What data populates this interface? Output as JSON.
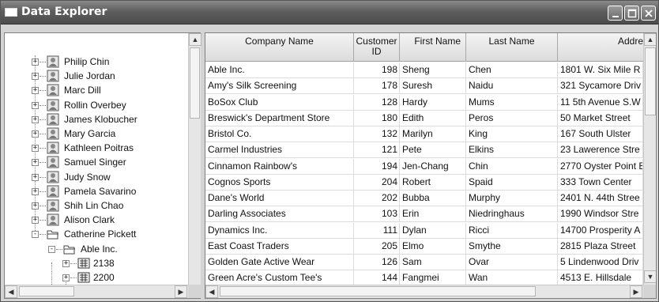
{
  "window": {
    "title": "Data Explorer"
  },
  "tree": {
    "nodes": [
      {
        "label": "Philip  Chin",
        "type": "person",
        "level": 1,
        "expander": "+"
      },
      {
        "label": "Julie  Jordan",
        "type": "person",
        "level": 1,
        "expander": "+"
      },
      {
        "label": "Marc  Dill",
        "type": "person",
        "level": 1,
        "expander": "+"
      },
      {
        "label": "Rollin  Overbey",
        "type": "person",
        "level": 1,
        "expander": "+"
      },
      {
        "label": "James  Klobucher",
        "type": "person",
        "level": 1,
        "expander": "+"
      },
      {
        "label": "Mary  Garcia",
        "type": "person",
        "level": 1,
        "expander": "+"
      },
      {
        "label": "Kathleen  Poitras",
        "type": "person",
        "level": 1,
        "expander": "+"
      },
      {
        "label": "Samuel  Singer",
        "type": "person",
        "level": 1,
        "expander": "+"
      },
      {
        "label": "Judy  Snow",
        "type": "person",
        "level": 1,
        "expander": "+"
      },
      {
        "label": "Pamela  Savarino",
        "type": "person",
        "level": 1,
        "expander": "+"
      },
      {
        "label": "Shih Lin  Chao",
        "type": "person",
        "level": 1,
        "expander": "+"
      },
      {
        "label": "Alison  Clark",
        "type": "person",
        "level": 1,
        "expander": "+"
      },
      {
        "label": "Catherine  Pickett",
        "type": "folder",
        "level": 1,
        "expander": "-"
      },
      {
        "label": "Able Inc.",
        "type": "folder",
        "level": 2,
        "expander": "-"
      },
      {
        "label": "2138",
        "type": "order",
        "level": 3,
        "expander": "+"
      },
      {
        "label": "2200",
        "type": "order",
        "level": 3,
        "expander": "+"
      }
    ]
  },
  "grid": {
    "columns": [
      {
        "label": "Company Name"
      },
      {
        "label": "Customer ID"
      },
      {
        "label": "First Name"
      },
      {
        "label": "Last Name"
      },
      {
        "label": "Addre"
      }
    ],
    "rows": [
      [
        "Able Inc.",
        "198",
        "Sheng",
        "Chen",
        "1801 W. Six Mile R"
      ],
      [
        "Amy's Silk Screening",
        "178",
        "Suresh",
        "Naidu",
        "321 Sycamore Driv"
      ],
      [
        "BoSox Club",
        "128",
        "Hardy",
        "Mums",
        "11 5th Avenue S.W"
      ],
      [
        "Breswick's Department Store",
        "180",
        "Edith",
        "Peros",
        "50 Market Street"
      ],
      [
        "Bristol Co.",
        "132",
        "Marilyn",
        "King",
        "167 South Ulster"
      ],
      [
        "Carmel Industries",
        "121",
        "Pete",
        "Elkins",
        "23 Lawerence Stre"
      ],
      [
        "Cinnamon Rainbow's",
        "194",
        "Jen-Chang",
        "Chin",
        "2770 Oyster Point E"
      ],
      [
        "Cognos Sports",
        "204",
        "Robert",
        "Spaid",
        "333 Town Center"
      ],
      [
        "Dane's World",
        "202",
        "Bubba",
        "Murphy",
        "2401 N. 44th Stree"
      ],
      [
        "Darling Associates",
        "103",
        "Erin",
        "Niedringhaus",
        "1990 Windsor Stre"
      ],
      [
        "Dynamics Inc.",
        "111",
        "Dylan",
        "Ricci",
        "14700 Prosperity A"
      ],
      [
        "East Coast Traders",
        "205",
        "Elmo",
        "Smythe",
        "2815 Plaza Street"
      ],
      [
        "Golden Gate Active Wear",
        "126",
        "Sam",
        "Ovar",
        "5 Lindenwood Driv"
      ],
      [
        "Green Acre's Custom Tee's",
        "144",
        "Fangmei",
        "Wan",
        "4513 E. Hillsdale"
      ]
    ]
  }
}
